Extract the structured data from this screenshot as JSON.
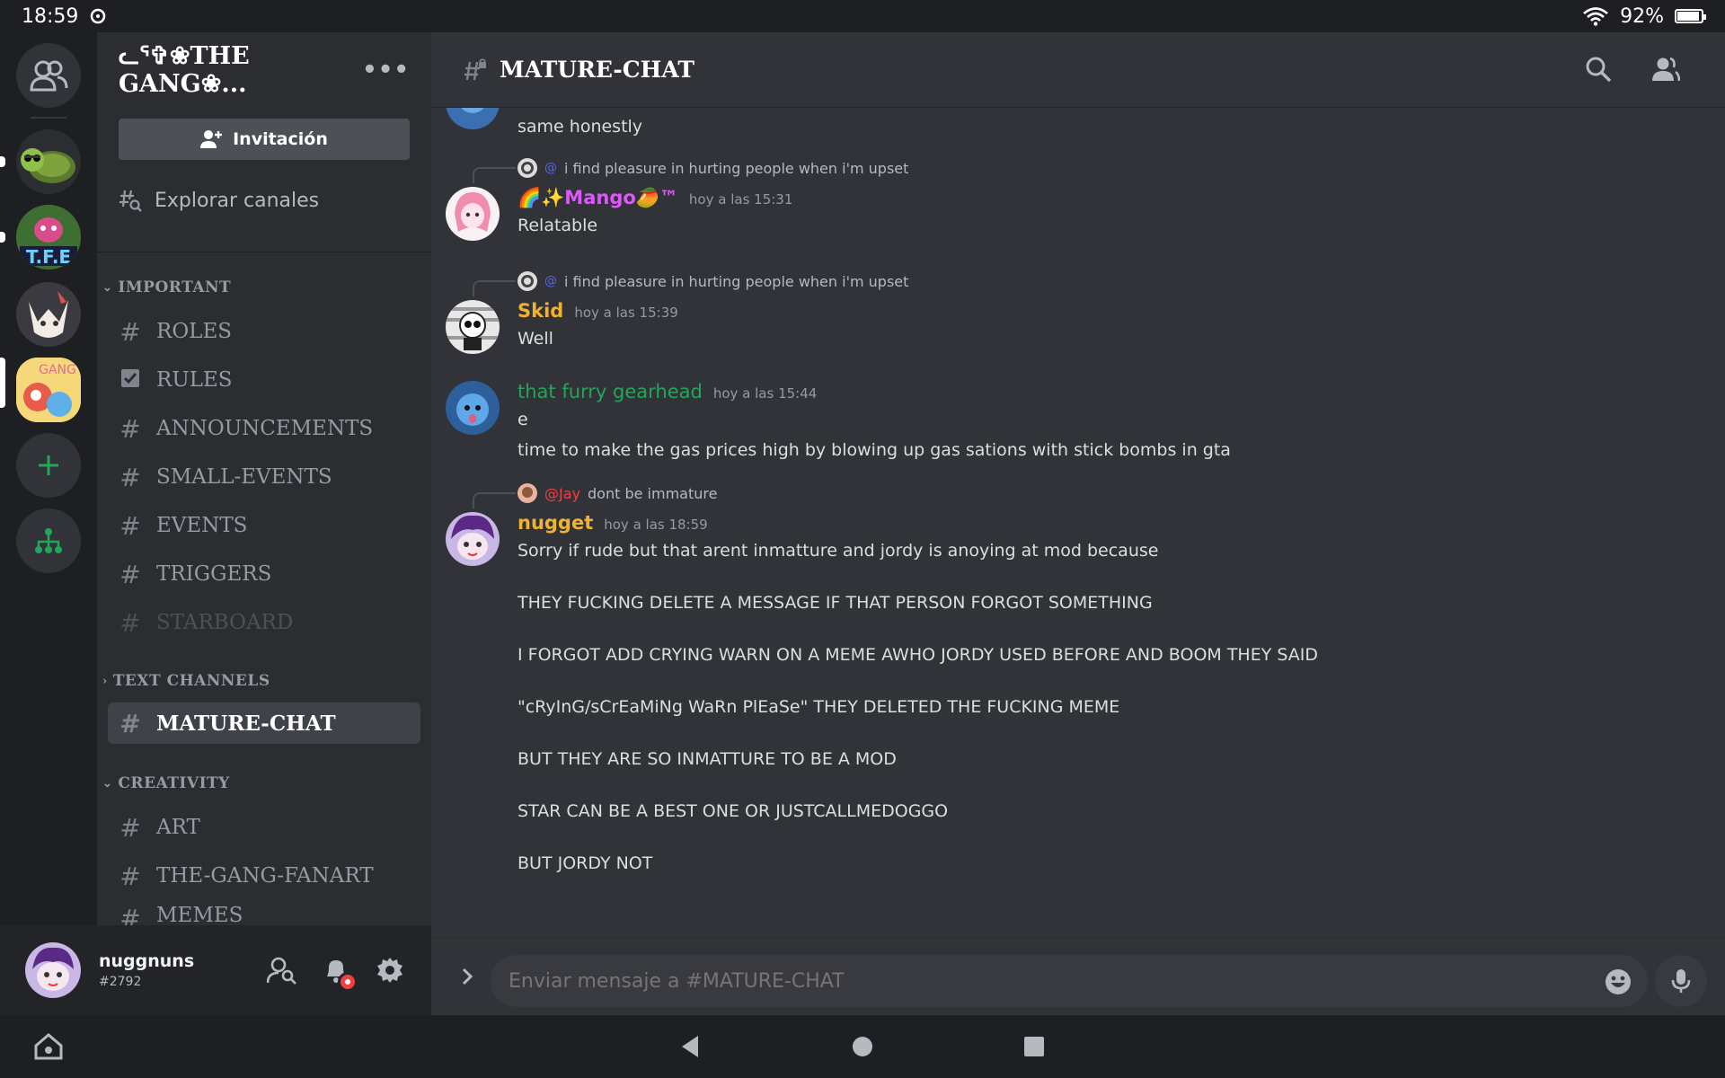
{
  "status_bar": {
    "time": "18:59",
    "battery": "92%"
  },
  "guild": {
    "name": "ᓚᕐ✞❀THE GANG❀...",
    "more_label": "•••"
  },
  "sidebar": {
    "invite_label": "Invitación",
    "explore_label": "Explorar canales",
    "categories": [
      {
        "name": "IMPORTANT",
        "channels": [
          {
            "name": "ROLES",
            "icon": "hash-icon"
          },
          {
            "name": "RULES",
            "icon": "rules-check-icon"
          },
          {
            "name": "ANNOUNCEMENTS",
            "icon": "hash-icon"
          },
          {
            "name": "SMALL-EVENTS",
            "icon": "hash-icon"
          },
          {
            "name": "EVENTS",
            "icon": "hash-icon"
          },
          {
            "name": "TRIGGERS",
            "icon": "hash-icon"
          },
          {
            "name": "STARBOARD",
            "icon": "hash-icon"
          }
        ]
      },
      {
        "name": "TEXT CHANNELS",
        "channels": [
          {
            "name": "MATURE-CHAT",
            "icon": "locked-hash-icon"
          }
        ]
      },
      {
        "name": "CREATIVITY",
        "channels": [
          {
            "name": "ART",
            "icon": "hash-icon"
          },
          {
            "name": "THE-GANG-FANART",
            "icon": "hash-icon"
          },
          {
            "name": "MEMES",
            "icon": "hash-icon"
          }
        ]
      }
    ]
  },
  "user": {
    "name": "nuggnuns",
    "tag": "#2792"
  },
  "chat": {
    "channel_title": "MATURE-CHAT",
    "messages": [
      {
        "lines": [
          "same honestly"
        ]
      },
      {
        "reply_text": "i find pleasure in hurting people when i'm upset",
        "author": "🌈✨Mango🥭™",
        "author_color": "#e056fd",
        "timestamp": "hoy a las 15:31",
        "lines": [
          "Relatable"
        ]
      },
      {
        "reply_text": "i find pleasure in hurting people when i'm upset",
        "author": "Skid",
        "author_color": "#f0b232",
        "timestamp": "hoy a las 15:39",
        "lines": [
          "Well"
        ]
      },
      {
        "author": "that furry gearhead",
        "author_color": "#23a55a",
        "timestamp": "hoy a las 15:44",
        "lines": [
          "e",
          "time to make the gas prices high by blowing up gas sations with stick bombs in gta"
        ]
      },
      {
        "reply_mention": "@Jay",
        "reply_text": "dont be immature",
        "author": "nugget",
        "author_color": "#f0b232",
        "timestamp": "hoy a las 18:59",
        "lines": [
          "Sorry if rude but that arent inmatture and jordy is anoying at mod because",
          "THEY FUCKING DELETE A MESSAGE IF THAT PERSON FORGOT SOMETHING",
          "I FORGOT ADD CRYING WARN ON A MEME AWHO JORDY USED BEFORE AND BOOM THEY SAID",
          "\"cRyInG/sCrEaMiNg WaRn PlEaSe\" THEY DELETED THE FUCKING MEME",
          "BUT THEY ARE SO INMATTURE TO BE A MOD",
          "STAR CAN BE A BEST ONE OR JUSTCALLMEDOGGO",
          "BUT JORDY NOT"
        ]
      }
    ],
    "composer_placeholder": "Enviar mensaje a #MATURE-CHAT"
  },
  "colors": {
    "accent": "#5865f2",
    "green": "#23a55a",
    "yellow": "#f0b232",
    "red": "#f23f43",
    "pink": "#e056fd"
  }
}
